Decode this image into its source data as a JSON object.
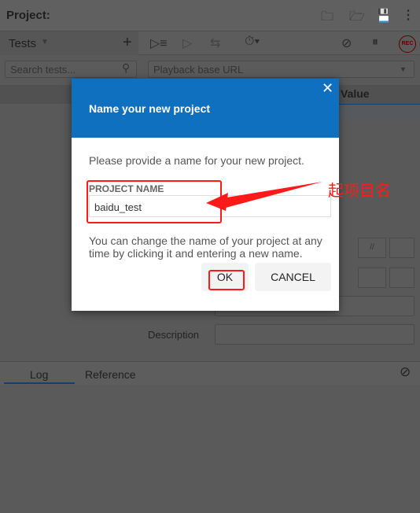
{
  "header": {
    "title": "Project:",
    "icons": [
      "new-folder-icon",
      "open-folder-icon",
      "save-icon",
      "more-vertical-icon"
    ]
  },
  "tests_panel": {
    "label": "Tests",
    "search_placeholder": "Search tests..."
  },
  "toolbar": {
    "playback_url_placeholder": "Playback base URL",
    "rec_label": "REC"
  },
  "grid": {
    "value_header": "Value"
  },
  "editor": {
    "description_label": "Description",
    "comment_glyph": "//"
  },
  "bottom": {
    "tabs": [
      {
        "label": "Log"
      },
      {
        "label": "Reference"
      }
    ]
  },
  "dialog": {
    "title": "Name your new project",
    "prompt": "Please provide a name for your new project.",
    "field_label": "PROJECT NAME",
    "field_value": "baidu_test",
    "note": "You can change the name of your project at any time by clicking it and entering a new name.",
    "ok_label": "OK",
    "cancel_label": "CANCEL"
  },
  "annotation": {
    "text": "起项目名",
    "color": "#ff1a1a"
  },
  "colors": {
    "accent": "#1070c0"
  }
}
